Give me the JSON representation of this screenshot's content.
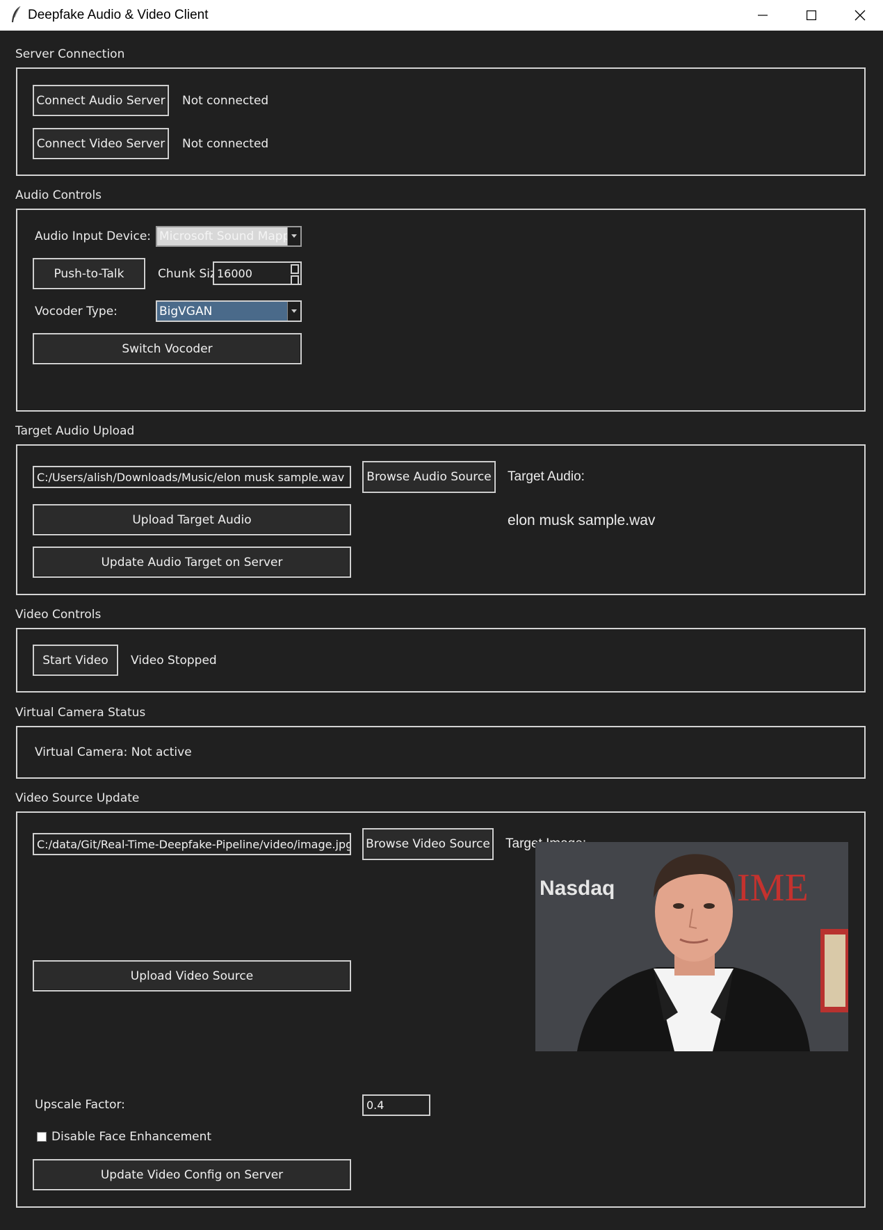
{
  "window": {
    "title": "Deepfake Audio & Video Client",
    "icons": [
      "feather-icon",
      "minimize-icon",
      "maximize-icon",
      "close-icon"
    ]
  },
  "server_connection": {
    "section_title": "Server Connection",
    "connect_audio_label": "Connect Audio Server",
    "audio_status": "Not connected",
    "connect_video_label": "Connect Video Server",
    "video_status": "Not connected"
  },
  "audio_controls": {
    "section_title": "Audio Controls",
    "input_device_label": "Audio Input Device:",
    "input_device_value": "Microsoft Sound Mapp",
    "push_to_talk_label": "Push-to-Talk",
    "chunk_size_label": "Chunk Siz",
    "chunk_size_value": "16000",
    "vocoder_label": "Vocoder Type:",
    "vocoder_value": "BigVGAN",
    "switch_vocoder_label": "Switch Vocoder"
  },
  "target_audio": {
    "section_title": "Target Audio Upload",
    "path_value": "C:/Users/alish/Downloads/Music/elon musk sample.wav",
    "browse_label": "Browse Audio Source",
    "target_label": "Target Audio:",
    "target_filename": "elon musk sample.wav",
    "upload_label": "Upload Target Audio",
    "update_label": "Update Audio Target on Server"
  },
  "video_controls": {
    "section_title": "Video Controls",
    "start_label": "Start Video",
    "status": "Video Stopped"
  },
  "virtual_camera": {
    "section_title": "Virtual Camera Status",
    "status": "Virtual Camera: Not active"
  },
  "video_source": {
    "section_title": "Video Source Update",
    "path_value": "C:/data/Git/Real-Time-Deepfake-Pipeline/video/image.jpg",
    "browse_label": "Browse Video Source",
    "target_label": "Target Image:",
    "upload_label": "Upload Video Source",
    "upscale_label": "Upscale Factor:",
    "upscale_value": "0.4",
    "disable_face_label": "Disable Face Enhancement",
    "disable_face_checked": false,
    "update_config_label": "Update Video Config on Server",
    "image_logo_text": "Nasdaq",
    "image_magazine_text": "IME"
  },
  "colors": {
    "background": "#202020",
    "selection": "#4a6a8a",
    "border": "#d4d4d4"
  }
}
